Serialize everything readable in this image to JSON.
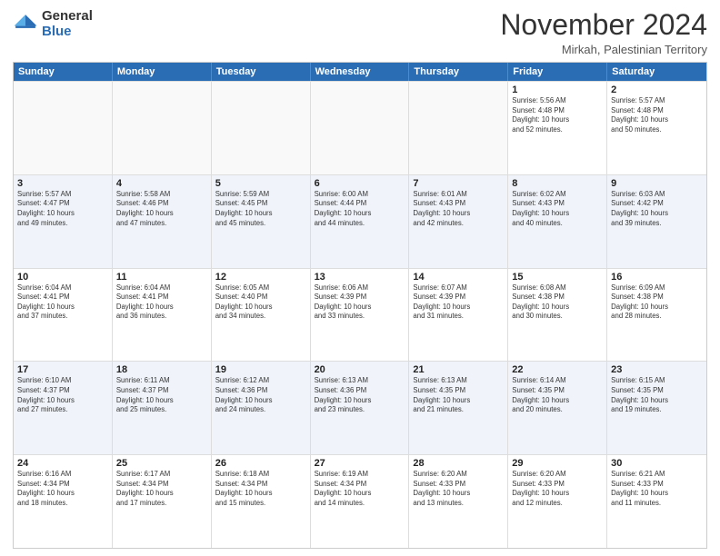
{
  "logo": {
    "general": "General",
    "blue": "Blue"
  },
  "title": "November 2024",
  "location": "Mirkah, Palestinian Territory",
  "days": [
    "Sunday",
    "Monday",
    "Tuesday",
    "Wednesday",
    "Thursday",
    "Friday",
    "Saturday"
  ],
  "rows": [
    [
      {
        "day": "",
        "info": "",
        "empty": true
      },
      {
        "day": "",
        "info": "",
        "empty": true
      },
      {
        "day": "",
        "info": "",
        "empty": true
      },
      {
        "day": "",
        "info": "",
        "empty": true
      },
      {
        "day": "",
        "info": "",
        "empty": true
      },
      {
        "day": "1",
        "info": "Sunrise: 5:56 AM\nSunset: 4:48 PM\nDaylight: 10 hours\nand 52 minutes."
      },
      {
        "day": "2",
        "info": "Sunrise: 5:57 AM\nSunset: 4:48 PM\nDaylight: 10 hours\nand 50 minutes."
      }
    ],
    [
      {
        "day": "3",
        "info": "Sunrise: 5:57 AM\nSunset: 4:47 PM\nDaylight: 10 hours\nand 49 minutes."
      },
      {
        "day": "4",
        "info": "Sunrise: 5:58 AM\nSunset: 4:46 PM\nDaylight: 10 hours\nand 47 minutes."
      },
      {
        "day": "5",
        "info": "Sunrise: 5:59 AM\nSunset: 4:45 PM\nDaylight: 10 hours\nand 45 minutes."
      },
      {
        "day": "6",
        "info": "Sunrise: 6:00 AM\nSunset: 4:44 PM\nDaylight: 10 hours\nand 44 minutes."
      },
      {
        "day": "7",
        "info": "Sunrise: 6:01 AM\nSunset: 4:43 PM\nDaylight: 10 hours\nand 42 minutes."
      },
      {
        "day": "8",
        "info": "Sunrise: 6:02 AM\nSunset: 4:43 PM\nDaylight: 10 hours\nand 40 minutes."
      },
      {
        "day": "9",
        "info": "Sunrise: 6:03 AM\nSunset: 4:42 PM\nDaylight: 10 hours\nand 39 minutes."
      }
    ],
    [
      {
        "day": "10",
        "info": "Sunrise: 6:04 AM\nSunset: 4:41 PM\nDaylight: 10 hours\nand 37 minutes."
      },
      {
        "day": "11",
        "info": "Sunrise: 6:04 AM\nSunset: 4:41 PM\nDaylight: 10 hours\nand 36 minutes."
      },
      {
        "day": "12",
        "info": "Sunrise: 6:05 AM\nSunset: 4:40 PM\nDaylight: 10 hours\nand 34 minutes."
      },
      {
        "day": "13",
        "info": "Sunrise: 6:06 AM\nSunset: 4:39 PM\nDaylight: 10 hours\nand 33 minutes."
      },
      {
        "day": "14",
        "info": "Sunrise: 6:07 AM\nSunset: 4:39 PM\nDaylight: 10 hours\nand 31 minutes."
      },
      {
        "day": "15",
        "info": "Sunrise: 6:08 AM\nSunset: 4:38 PM\nDaylight: 10 hours\nand 30 minutes."
      },
      {
        "day": "16",
        "info": "Sunrise: 6:09 AM\nSunset: 4:38 PM\nDaylight: 10 hours\nand 28 minutes."
      }
    ],
    [
      {
        "day": "17",
        "info": "Sunrise: 6:10 AM\nSunset: 4:37 PM\nDaylight: 10 hours\nand 27 minutes."
      },
      {
        "day": "18",
        "info": "Sunrise: 6:11 AM\nSunset: 4:37 PM\nDaylight: 10 hours\nand 25 minutes."
      },
      {
        "day": "19",
        "info": "Sunrise: 6:12 AM\nSunset: 4:36 PM\nDaylight: 10 hours\nand 24 minutes."
      },
      {
        "day": "20",
        "info": "Sunrise: 6:13 AM\nSunset: 4:36 PM\nDaylight: 10 hours\nand 23 minutes."
      },
      {
        "day": "21",
        "info": "Sunrise: 6:13 AM\nSunset: 4:35 PM\nDaylight: 10 hours\nand 21 minutes."
      },
      {
        "day": "22",
        "info": "Sunrise: 6:14 AM\nSunset: 4:35 PM\nDaylight: 10 hours\nand 20 minutes."
      },
      {
        "day": "23",
        "info": "Sunrise: 6:15 AM\nSunset: 4:35 PM\nDaylight: 10 hours\nand 19 minutes."
      }
    ],
    [
      {
        "day": "24",
        "info": "Sunrise: 6:16 AM\nSunset: 4:34 PM\nDaylight: 10 hours\nand 18 minutes."
      },
      {
        "day": "25",
        "info": "Sunrise: 6:17 AM\nSunset: 4:34 PM\nDaylight: 10 hours\nand 17 minutes."
      },
      {
        "day": "26",
        "info": "Sunrise: 6:18 AM\nSunset: 4:34 PM\nDaylight: 10 hours\nand 15 minutes."
      },
      {
        "day": "27",
        "info": "Sunrise: 6:19 AM\nSunset: 4:34 PM\nDaylight: 10 hours\nand 14 minutes."
      },
      {
        "day": "28",
        "info": "Sunrise: 6:20 AM\nSunset: 4:33 PM\nDaylight: 10 hours\nand 13 minutes."
      },
      {
        "day": "29",
        "info": "Sunrise: 6:20 AM\nSunset: 4:33 PM\nDaylight: 10 hours\nand 12 minutes."
      },
      {
        "day": "30",
        "info": "Sunrise: 6:21 AM\nSunset: 4:33 PM\nDaylight: 10 hours\nand 11 minutes."
      }
    ]
  ]
}
